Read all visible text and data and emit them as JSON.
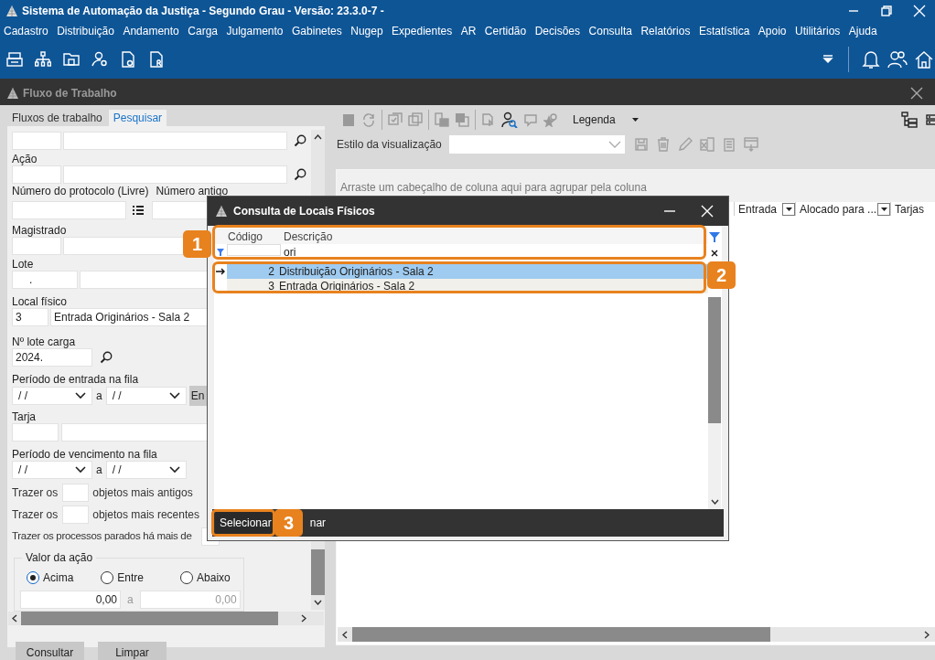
{
  "window": {
    "title": "Sistema de Automação da Justiça - Segundo Grau - Versão: 23.3.0-7 -"
  },
  "menu": [
    "Cadastro",
    "Distribuição",
    "Andamento",
    "Carga",
    "Julgamento",
    "Gabinetes",
    "Nugep",
    "Expedientes",
    "AR",
    "Certidão",
    "Decisões",
    "Consulta",
    "Relatórios",
    "Estatística",
    "Apoio",
    "Utilitários",
    "Ajuda"
  ],
  "workflow": {
    "title": "Fluxo de Trabalho"
  },
  "tabs": [
    {
      "label": "Fluxos de trabalho",
      "selected": false
    },
    {
      "label": "Pesquisar",
      "selected": true
    }
  ],
  "form": {
    "acao_label": "Ação",
    "protocolo_label": "Número do protocolo (Livre)",
    "numero_antigo_label": "Número antigo",
    "magistrado_label": "Magistrado",
    "lote_label": "Lote",
    "lote_value": ".",
    "local_label": "Local físico",
    "local_code": "3",
    "local_desc": "Entrada Originários - Sala 2",
    "lote_carga_label": "Nº lote carga",
    "lote_carga_value": "2024.",
    "entrada_label": "Período de entrada na fila",
    "entrada_from": "/ /",
    "entrada_sep": "a",
    "entrada_to": "/ /",
    "entrada_button": "En",
    "tarja_label": "Tarja",
    "venc_label": "Período de vencimento na fila",
    "venc_from": "/ /",
    "venc_sep": "a",
    "venc_to": "/ /",
    "antigos_prefix": "Trazer os",
    "antigos_suffix": "objetos mais antigos",
    "recentes_prefix": "Trazer os",
    "recentes_suffix": "objetos mais recentes",
    "parados_label": "Trazer os processos parados há mais de",
    "valor": {
      "title": "Valor da ação",
      "options": [
        {
          "label": "Acima",
          "selected": true
        },
        {
          "label": "Entre",
          "selected": false
        },
        {
          "label": "Abaixo",
          "selected": false
        }
      ],
      "from": "0,00",
      "sep": "a",
      "to": "0,00"
    }
  },
  "form_buttons": [
    "Consultar",
    "Limpar"
  ],
  "view": {
    "legend": "Legenda",
    "style_label": "Estilo da visualização",
    "group_hint": "Arraste um cabeçalho de coluna aqui para agrupar pela coluna",
    "columns": [
      "Entrada",
      "Alocado para ...",
      "Tarjas"
    ]
  },
  "dialog": {
    "title": "Consulta de Locais Físicos",
    "columns": [
      "Código",
      "Descrição"
    ],
    "filter_value": "ori",
    "rows": [
      {
        "code": "2",
        "description": "Distribuição Originários - Sala 2",
        "selected": true
      },
      {
        "code": "3",
        "description": "Entrada Originários - Sala 2",
        "selected": false
      }
    ],
    "select_button": "Selecionar",
    "other_button": "nar"
  },
  "callouts": [
    "1",
    "2",
    "3"
  ]
}
